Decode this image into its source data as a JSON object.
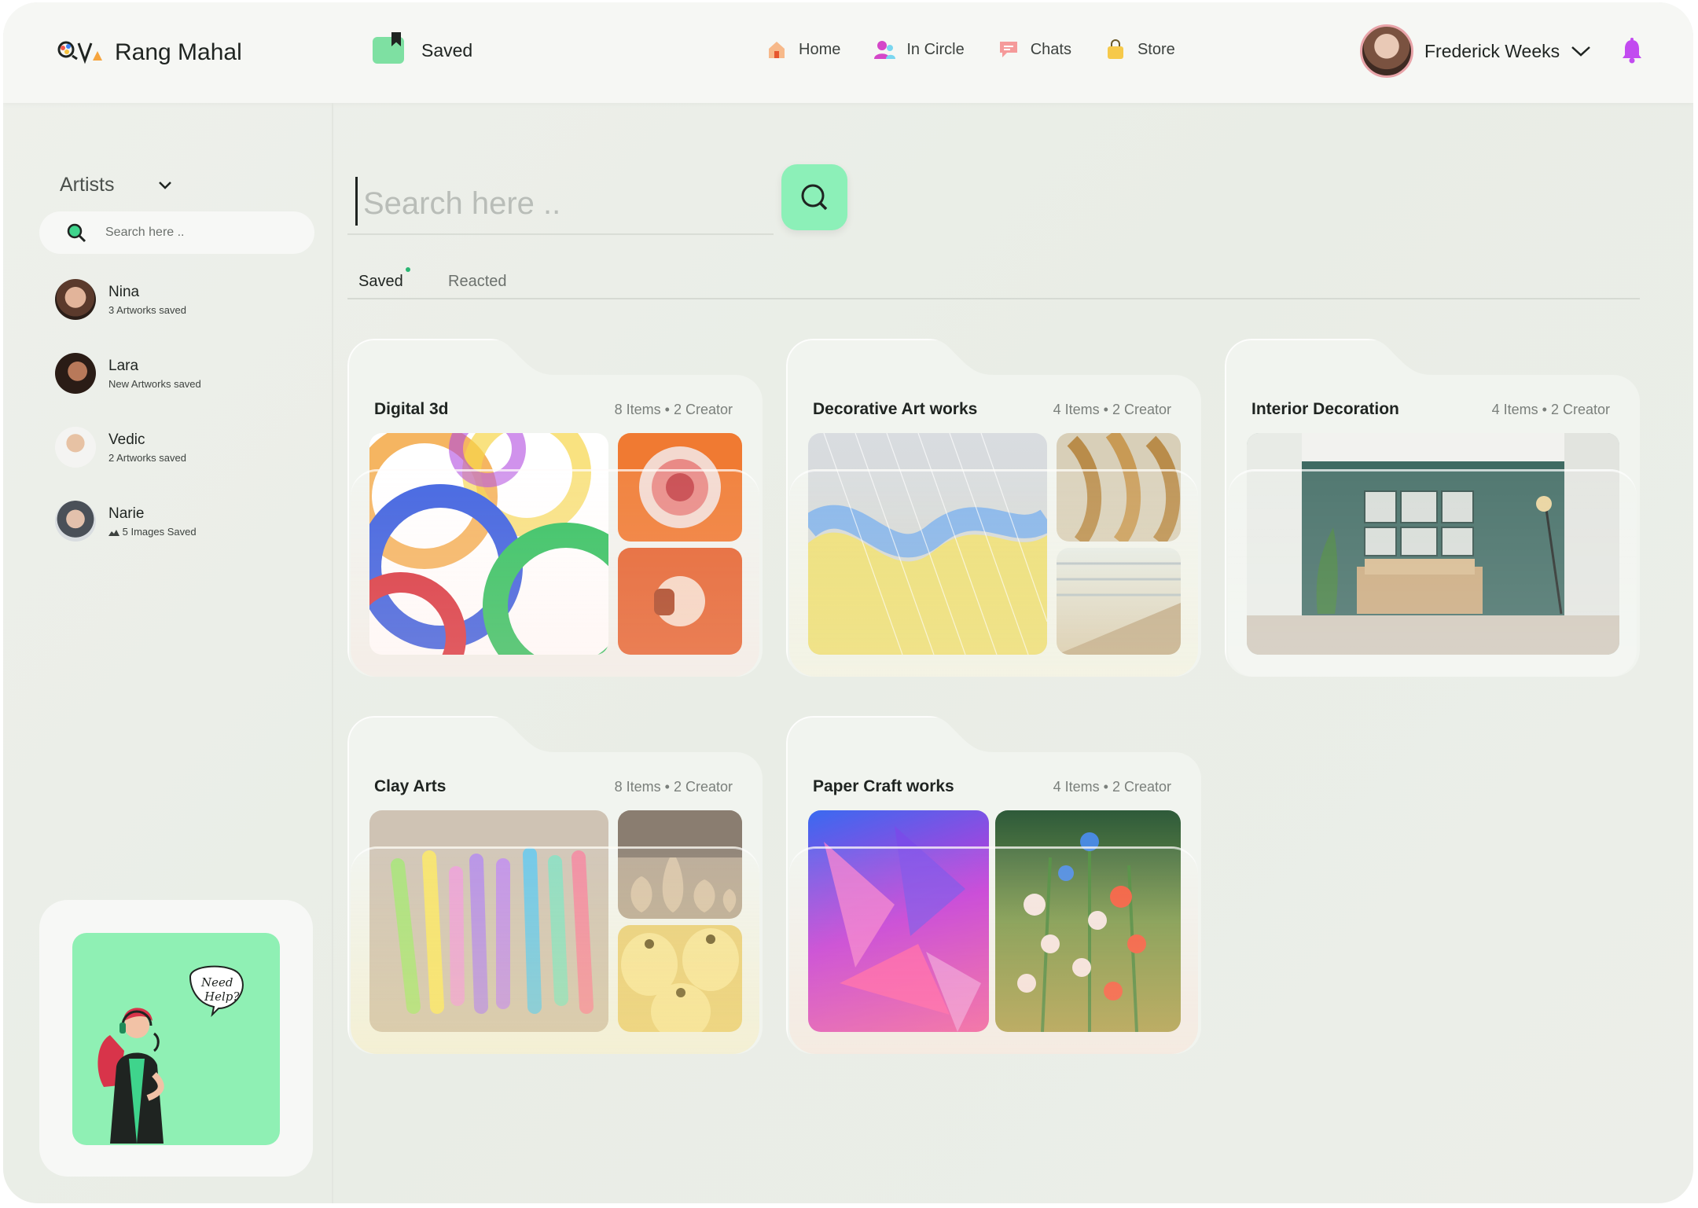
{
  "brand": {
    "name": "Rang Mahal"
  },
  "header": {
    "section_label": "Saved",
    "nav": [
      {
        "label": "Home",
        "icon": "home-icon"
      },
      {
        "label": "In Circle",
        "icon": "people-icon"
      },
      {
        "label": "Chats",
        "icon": "chat-icon"
      },
      {
        "label": "Store",
        "icon": "bag-icon"
      }
    ],
    "user_name": "Frederick Weeks"
  },
  "sidebar": {
    "filter_label": "Artists",
    "search_placeholder": "Search here ..",
    "artists": [
      {
        "name": "Nina",
        "sub": "3 Artworks saved"
      },
      {
        "name": "Lara",
        "sub": "New Artworks saved"
      },
      {
        "name": "Vedic",
        "sub": "2 Artworks saved"
      },
      {
        "name": "Narie",
        "sub": "5 Images Saved"
      }
    ],
    "help_text_1": "Need",
    "help_text_2": "Help?"
  },
  "main": {
    "search_placeholder": "Search here ..",
    "tabs": [
      {
        "label": "Saved"
      },
      {
        "label": "Reacted"
      }
    ],
    "folders": [
      {
        "title": "Digital 3d",
        "meta": "8 Items • 2 Creator"
      },
      {
        "title": "Decorative Art works",
        "meta": "4 Items • 2 Creator"
      },
      {
        "title": "Interior Decoration",
        "meta": "4 Items • 2 Creator"
      },
      {
        "title": "Clay Arts",
        "meta": "8 Items • 2 Creator"
      },
      {
        "title": "Paper Craft works",
        "meta": "4 Items • 2 Creator"
      }
    ]
  },
  "colors": {
    "accent": "#8cf0b8",
    "help_bg": "#8ff0b4",
    "bell": "#c24bf0",
    "active_dot": "#2bb673"
  }
}
